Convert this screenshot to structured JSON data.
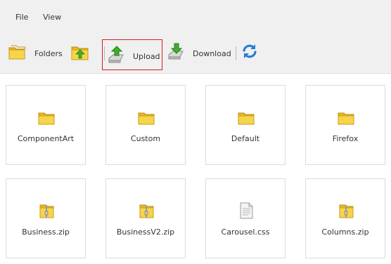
{
  "menu": {
    "file": "File",
    "view": "View"
  },
  "toolbar": {
    "folders_label": "Folders",
    "upload_label": "Upload",
    "download_label": "Download"
  },
  "tiles": [
    {
      "name": "ComponentArt",
      "icon": "folder-icon"
    },
    {
      "name": "Custom",
      "icon": "folder-icon"
    },
    {
      "name": "Default",
      "icon": "folder-icon"
    },
    {
      "name": "Firefox",
      "icon": "folder-icon"
    },
    {
      "name": "Business.zip",
      "icon": "zip-folder-icon"
    },
    {
      "name": "BusinessV2.zip",
      "icon": "zip-folder-icon"
    },
    {
      "name": "Carousel.css",
      "icon": "document-icon"
    },
    {
      "name": "Columns.zip",
      "icon": "zip-folder-icon"
    }
  ],
  "colors": {
    "chrome_bg": "#f0f0f0",
    "highlight_border": "#d42020",
    "folder_yellow": "#f7d54a",
    "arrow_green": "#3fae2a",
    "refresh_blue": "#2a7bd8"
  }
}
